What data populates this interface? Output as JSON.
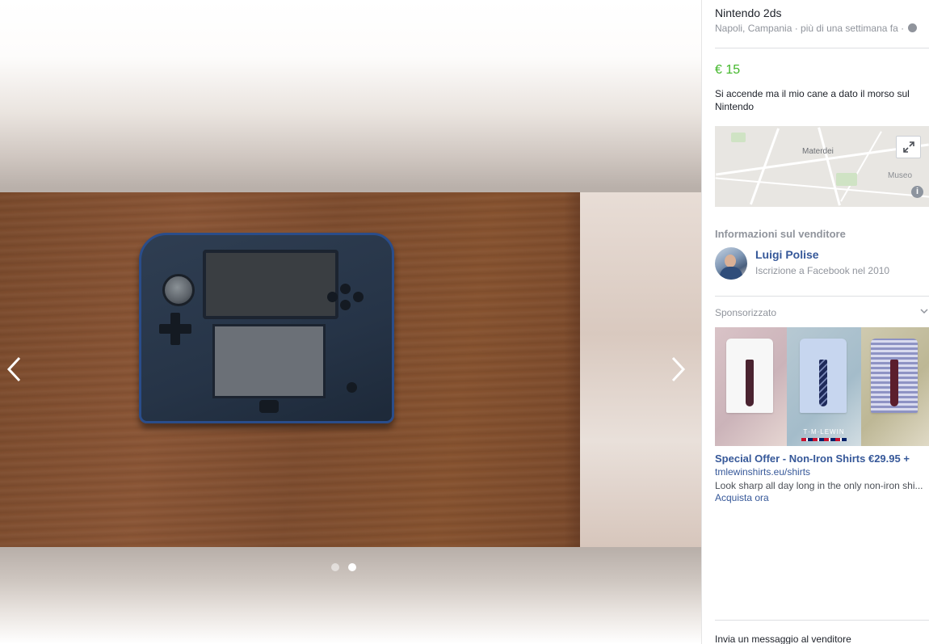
{
  "listing": {
    "title": "Nintendo 2ds",
    "location_time": "Napoli, Campania · più di una settimana fa ·",
    "price": "€ 15",
    "description": "Si accende ma il mio cane a dato il morso sul Nintendo"
  },
  "map": {
    "labels": [
      "Materdei",
      "Museo"
    ],
    "expand_icon": "expand-arrows-icon",
    "info_icon": "info-icon"
  },
  "seller": {
    "heading": "Informazioni sul venditore",
    "name": "Luigi Polise",
    "joined": "Iscrizione a Facebook nel 2010"
  },
  "sponsored": {
    "heading": "Sponsorizzato",
    "brand": "T·M·LEWIN",
    "title": "Special Offer - Non-Iron Shirts €29.95 +",
    "url": "tmlewinshirts.eu/shirts",
    "text": "Look sharp all day long in the only non-iron shi...",
    "cta": "Acquista ora"
  },
  "gallery": {
    "prev_icon": "chevron-left-icon",
    "next_icon": "chevron-right-icon",
    "slides": 2,
    "active_slide": 2
  },
  "footer": {
    "message_link": "Invia un messaggio al venditore"
  },
  "colors": {
    "price": "#42b72a",
    "link": "#365899",
    "muted": "#90949c"
  }
}
